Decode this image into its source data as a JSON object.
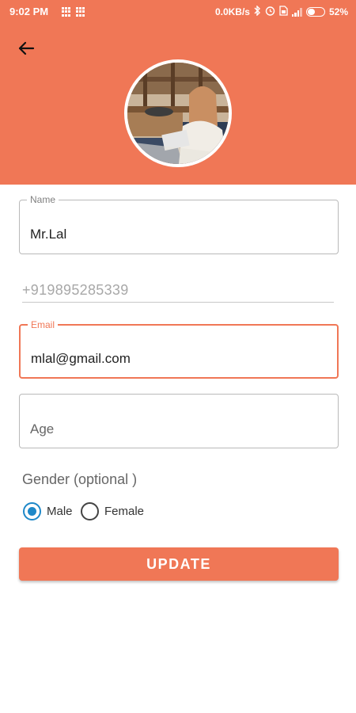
{
  "status_bar": {
    "time": "9:02 PM",
    "net_speed": "0.0KB/s",
    "battery": "52%"
  },
  "colors": {
    "accent": "#F07756",
    "radio_checked": "#1E88C8"
  },
  "profile": {
    "name_label": "Name",
    "name_value": "Mr.Lal",
    "phone_value": "+919895285339",
    "email_label": "Email",
    "email_value": "mlal@gmail.com",
    "age_placeholder": "Age"
  },
  "gender": {
    "label": "Gender (optional )",
    "options": [
      {
        "label": "Male",
        "selected": true
      },
      {
        "label": "Female",
        "selected": false
      }
    ]
  },
  "actions": {
    "update_label": "UPDATE"
  },
  "icons": {
    "back": "arrow-left-icon",
    "avatar": "profile-photo"
  }
}
